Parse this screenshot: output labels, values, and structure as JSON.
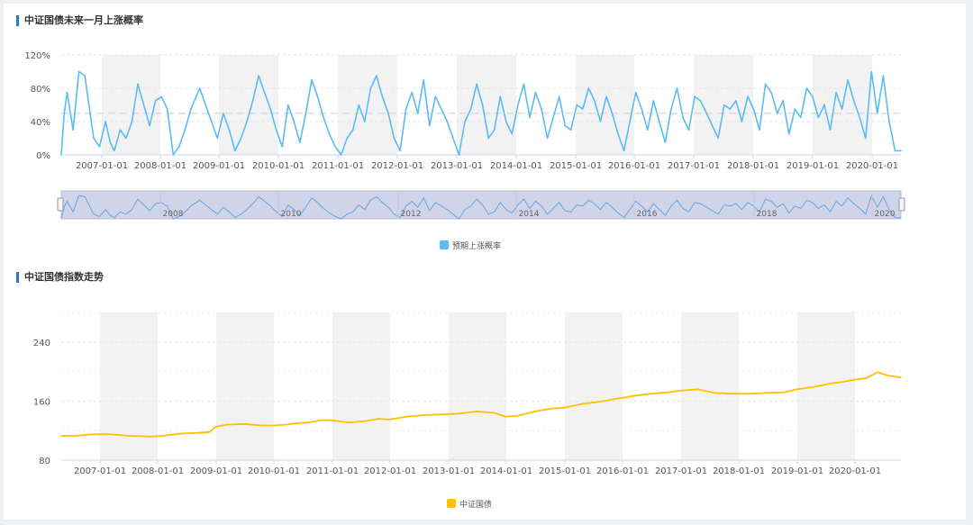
{
  "colors": {
    "prob_series": "#5bbcf4",
    "index_series": "#ffc000",
    "band": "#f2f2f2",
    "accent_bar": "#2b78c2"
  },
  "chart1_title": "中证国债未来一月上涨概率",
  "chart2_title": "中证国债指数走势",
  "navigator_labels": [
    "2008",
    "2010",
    "2012",
    "2014",
    "2016",
    "2018",
    "2020"
  ],
  "chart_data": [
    {
      "type": "line",
      "title": "中证国债未来一月上涨概率",
      "xlabel": "",
      "ylabel": "",
      "ylim": [
        0,
        120
      ],
      "y_ticks": [
        "0%",
        "40%",
        "80%",
        "120%"
      ],
      "x_ticks": [
        "2007-01-01",
        "2008-01-01",
        "2009-01-01",
        "2010-01-01",
        "2011-01-01",
        "2012-01-01",
        "2013-01-01",
        "2014-01-01",
        "2015-01-01",
        "2016-01-01",
        "2017-01-01",
        "2018-01-01",
        "2019-01-01",
        "2020-01-01"
      ],
      "reference_line": 50,
      "x_range": [
        2006.15,
        2020.4
      ],
      "series": [
        {
          "name": "预期上涨概率",
          "x": [
            2006.15,
            2006.2,
            2006.25,
            2006.35,
            2006.45,
            2006.55,
            2006.6,
            2006.7,
            2006.8,
            2006.9,
            2006.98,
            2007.05,
            2007.15,
            2007.25,
            2007.35,
            2007.45,
            2007.55,
            2007.65,
            2007.75,
            2007.85,
            2007.95,
            2008.05,
            2008.15,
            2008.25,
            2008.35,
            2008.5,
            2008.6,
            2008.7,
            2008.8,
            2008.9,
            2009.0,
            2009.1,
            2009.2,
            2009.3,
            2009.4,
            2009.5,
            2009.6,
            2009.7,
            2009.8,
            2009.9,
            2010.0,
            2010.1,
            2010.2,
            2010.3,
            2010.4,
            2010.5,
            2010.6,
            2010.7,
            2010.8,
            2010.9,
            2011.0,
            2011.1,
            2011.2,
            2011.3,
            2011.4,
            2011.5,
            2011.6,
            2011.7,
            2011.8,
            2011.9,
            2012.0,
            2012.1,
            2012.2,
            2012.3,
            2012.4,
            2012.5,
            2012.6,
            2012.7,
            2012.8,
            2012.9,
            2013.0,
            2013.1,
            2013.2,
            2013.3,
            2013.4,
            2013.5,
            2013.6,
            2013.7,
            2013.8,
            2013.9,
            2014.0,
            2014.1,
            2014.2,
            2014.3,
            2014.4,
            2014.5,
            2014.6,
            2014.7,
            2014.8,
            2014.9,
            2015.0,
            2015.1,
            2015.2,
            2015.3,
            2015.4,
            2015.5,
            2015.6,
            2015.7,
            2015.8,
            2015.9,
            2016.0,
            2016.1,
            2016.2,
            2016.3,
            2016.4,
            2016.5,
            2016.6,
            2016.7,
            2016.8,
            2016.9,
            2017.0,
            2017.1,
            2017.2,
            2017.3,
            2017.4,
            2017.5,
            2017.6,
            2017.7,
            2017.8,
            2017.9,
            2018.0,
            2018.1,
            2018.2,
            2018.3,
            2018.4,
            2018.5,
            2018.6,
            2018.7,
            2018.8,
            2018.9,
            2019.0,
            2019.1,
            2019.2,
            2019.3,
            2019.4,
            2019.5,
            2019.6,
            2019.7,
            2019.8,
            2019.9,
            2020.0,
            2020.1,
            2020.2,
            2020.3,
            2020.4
          ],
          "values": [
            0,
            50,
            75,
            30,
            100,
            95,
            70,
            20,
            10,
            40,
            15,
            5,
            30,
            20,
            40,
            85,
            60,
            35,
            65,
            70,
            55,
            0,
            10,
            30,
            55,
            80,
            60,
            40,
            20,
            50,
            30,
            5,
            20,
            40,
            65,
            95,
            75,
            55,
            30,
            10,
            60,
            40,
            15,
            50,
            90,
            70,
            45,
            25,
            10,
            0,
            20,
            30,
            60,
            40,
            80,
            95,
            70,
            50,
            20,
            5,
            55,
            75,
            50,
            90,
            35,
            70,
            55,
            40,
            20,
            0,
            40,
            55,
            85,
            60,
            20,
            30,
            70,
            40,
            25,
            60,
            85,
            45,
            75,
            55,
            20,
            45,
            70,
            35,
            30,
            60,
            55,
            80,
            65,
            40,
            70,
            50,
            25,
            5,
            40,
            75,
            55,
            30,
            65,
            40,
            15,
            55,
            80,
            45,
            30,
            70,
            65,
            50,
            35,
            20,
            60,
            55,
            65,
            40,
            70,
            55,
            30,
            85,
            75,
            50,
            65,
            25,
            55,
            45,
            80,
            70,
            45,
            60,
            30,
            75,
            55,
            90,
            65,
            45,
            20,
            100,
            50,
            95,
            40,
            5,
            5
          ]
        }
      ]
    },
    {
      "type": "line",
      "title": "中证国债指数走势",
      "xlabel": "",
      "ylabel": "",
      "ylim": [
        80,
        280
      ],
      "y_ticks": [
        "80",
        "160",
        "240"
      ],
      "x_ticks": [
        "2007-01-01",
        "2008-01-01",
        "2009-01-01",
        "2010-01-01",
        "2011-01-01",
        "2012-01-01",
        "2013-01-01",
        "2014-01-01",
        "2015-01-01",
        "2016-01-01",
        "2017-01-01",
        "2018-01-01",
        "2019-01-01",
        "2020-01-01"
      ],
      "x_range": [
        2006.35,
        2020.8
      ],
      "series": [
        {
          "name": "中证国债",
          "x": [
            2006.35,
            2006.6,
            2006.9,
            2007.2,
            2007.5,
            2007.9,
            2008.1,
            2008.4,
            2008.7,
            2008.9,
            2009.0,
            2009.2,
            2009.5,
            2009.8,
            2010.0,
            2010.2,
            2010.4,
            2010.6,
            2010.8,
            2011.0,
            2011.3,
            2011.6,
            2011.8,
            2012.0,
            2012.3,
            2012.6,
            2012.9,
            2013.2,
            2013.5,
            2013.8,
            2014.0,
            2014.2,
            2014.5,
            2014.8,
            2015.0,
            2015.3,
            2015.6,
            2015.9,
            2016.2,
            2016.5,
            2016.8,
            2017.0,
            2017.3,
            2017.6,
            2017.9,
            2018.2,
            2018.5,
            2018.8,
            2019.0,
            2019.3,
            2019.6,
            2019.8,
            2020.0,
            2020.2,
            2020.4,
            2020.6,
            2020.8
          ],
          "values": [
            113,
            113,
            115,
            115,
            113,
            112,
            113,
            116,
            117,
            118,
            125,
            128,
            129,
            127,
            127,
            128,
            130,
            131,
            134,
            134,
            131,
            133,
            136,
            135,
            139,
            141,
            142,
            143,
            146,
            144,
            139,
            140,
            146,
            150,
            151,
            156,
            159,
            163,
            167,
            170,
            172,
            174,
            176,
            171,
            170,
            170,
            171,
            172,
            176,
            179,
            184,
            186,
            189,
            191,
            199,
            194,
            192
          ]
        }
      ]
    }
  ]
}
